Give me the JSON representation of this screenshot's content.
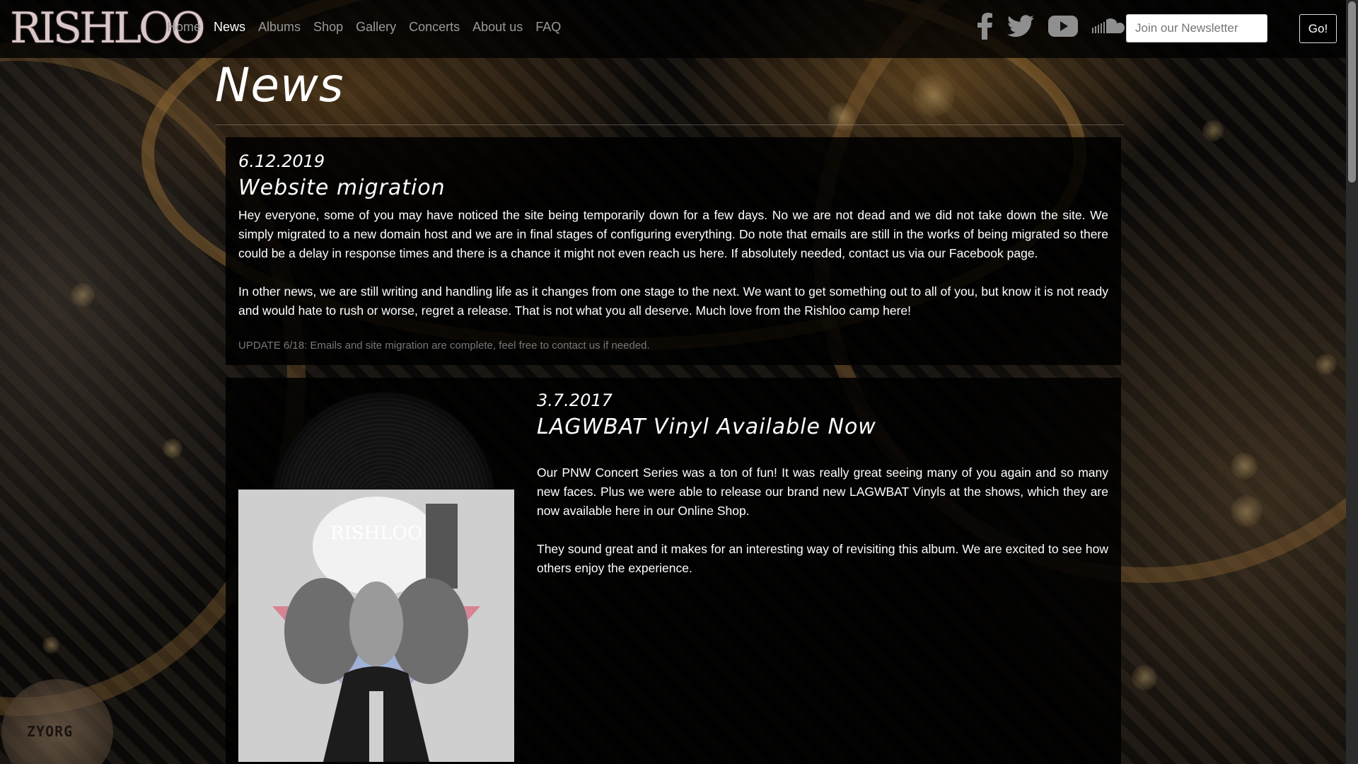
{
  "brand": {
    "logo_text": "RISHLOO"
  },
  "nav": {
    "items": [
      {
        "label": "Home",
        "active": false
      },
      {
        "label": "News",
        "active": true
      },
      {
        "label": "Albums",
        "active": false
      },
      {
        "label": "Shop",
        "active": false
      },
      {
        "label": "Gallery",
        "active": false
      },
      {
        "label": "Concerts",
        "active": false
      },
      {
        "label": "About us",
        "active": false
      },
      {
        "label": "FAQ",
        "active": false
      }
    ]
  },
  "social": [
    "facebook-icon",
    "twitter-icon",
    "youtube-icon",
    "soundcloud-icon"
  ],
  "newsletter": {
    "placeholder": "Join our Newsletter",
    "button_label": "Go!"
  },
  "page": {
    "title": "News"
  },
  "posts": [
    {
      "date": "6.12.2019",
      "title": "Website migration",
      "paragraphs": [
        "Hey everyone, some of you may have noticed the site being temporarily down for a few days. No we are not dead and we did not take down the site. We simply migrated to a new domain host and we are in final stages of configuring everything. Do note that emails are still in the works of being migrated so there could be a delay in response times and there is a chance it might not even reach us here. If absolutely needed, contact us via our Facebook page.",
        "In other news, we are still writing and handling life as it changes from one stage to the next. We want to get something out to all of you, but know it is not ready and would hate to rush or worse, regret a release. That is not what you all deserve. Much love from the Rishloo camp here!"
      ],
      "update": "UPDATE 6/18: Emails and site migration are complete, feel free to contact us if needed."
    },
    {
      "date": "3.7.2017",
      "title": "LAGWBAT Vinyl Available Now",
      "paragraphs": [
        "Our PNW Concert Series was a ton of fun! It was really great seeing many of you again and so many new faces. Plus we were able to release our brand new LAGWBAT Vinyls at the shows, which they are now available here in our Online Shop.",
        "They sound great and it makes for an interesting way of revisiting this album. We are excited to see how others enjoy the experience."
      ],
      "cover_logo": "RISHLOO"
    }
  ],
  "badge": {
    "text": "ZYORG"
  }
}
